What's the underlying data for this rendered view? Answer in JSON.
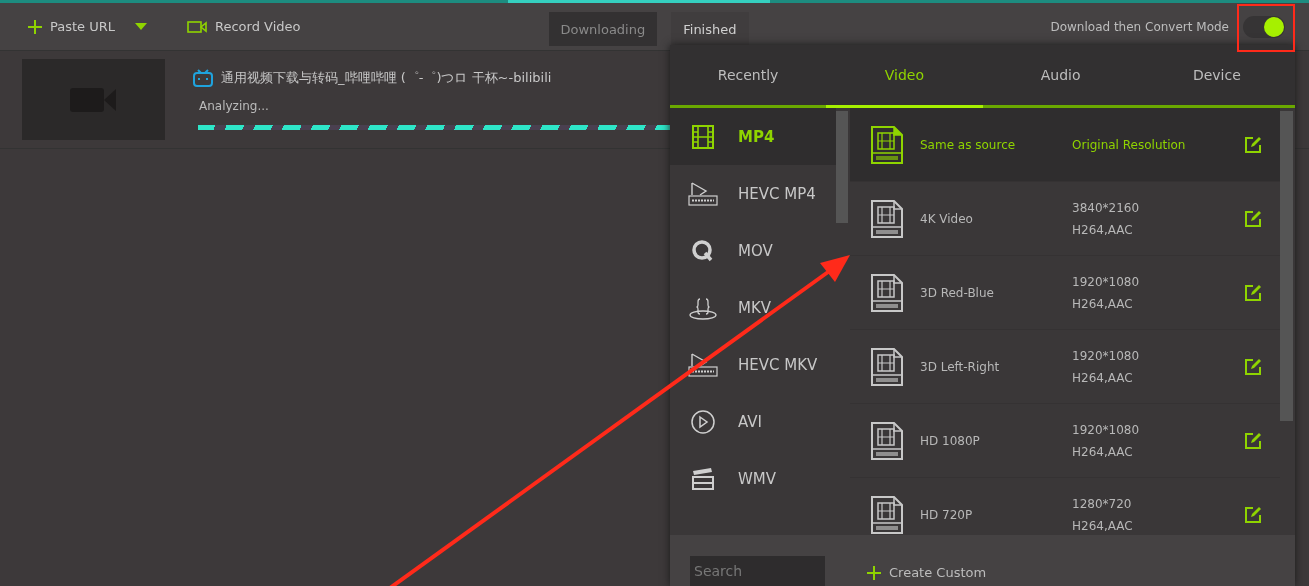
{
  "toolbar": {
    "paste_url": "Paste URL",
    "record_video": "Record Video",
    "tabs": [
      {
        "label": "Downloading",
        "selected": true
      },
      {
        "label": "Finished",
        "selected": false
      }
    ],
    "mode_label": "Download then Convert Mode",
    "mode_toggle": {
      "on": true
    }
  },
  "downloads": [
    {
      "title": "通用视频下载与转码_哔哩哔哩 (゜-゜)つロ 干杯~-bilibili",
      "status": "Analyzing...",
      "level": 1
    }
  ],
  "format_panel": {
    "tabs": [
      {
        "label": "Recently",
        "selected": false
      },
      {
        "label": "Video",
        "selected": true
      },
      {
        "label": "Audio",
        "selected": false
      },
      {
        "label": "Device",
        "selected": false
      }
    ],
    "formats": [
      {
        "label": "MP4",
        "kind": "film",
        "selected": true
      },
      {
        "label": "HEVC MP4",
        "kind": "hevc",
        "selected": false
      },
      {
        "label": "MOV",
        "kind": "quicktime",
        "selected": false
      },
      {
        "label": "MKV",
        "kind": "bracket",
        "selected": false
      },
      {
        "label": "HEVC MKV",
        "kind": "hevc",
        "selected": false
      },
      {
        "label": "AVI",
        "kind": "play",
        "selected": false
      },
      {
        "label": "WMV",
        "kind": "clapper",
        "selected": false
      }
    ],
    "presets": [
      {
        "name": "Same as source",
        "spec": [
          "Original Resolution"
        ],
        "selected": true
      },
      {
        "name": "4K Video",
        "spec": [
          "3840*2160",
          "H264,AAC"
        ],
        "selected": false
      },
      {
        "name": "3D Red-Blue",
        "spec": [
          "1920*1080",
          "H264,AAC"
        ],
        "selected": false
      },
      {
        "name": "3D Left-Right",
        "spec": [
          "1920*1080",
          "H264,AAC"
        ],
        "selected": false
      },
      {
        "name": "HD 1080P",
        "spec": [
          "1920*1080",
          "H264,AAC"
        ],
        "selected": false
      },
      {
        "name": "HD 720P",
        "spec": [
          "1280*720",
          "H264,AAC"
        ],
        "selected": false
      }
    ],
    "search": {
      "placeholder": "Search"
    },
    "create_custom": "Create Custom"
  }
}
